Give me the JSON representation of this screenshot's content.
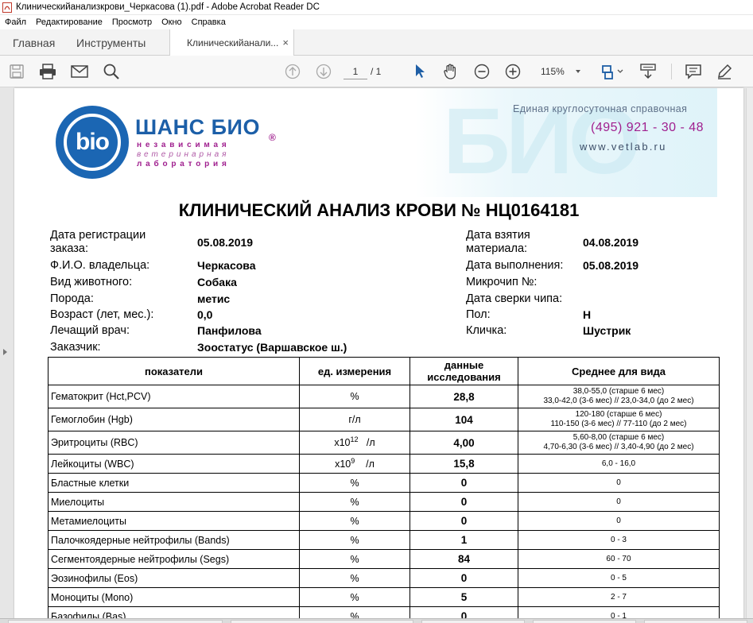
{
  "window": {
    "title": "Клиническийанализкрови_Черкасова (1).pdf - Adobe Acrobat Reader DC"
  },
  "menu": [
    "Файл",
    "Редактирование",
    "Просмотр",
    "Окно",
    "Справка"
  ],
  "tabs": {
    "home": "Главная",
    "tools": "Инструменты",
    "document": "Клиническийанали...",
    "close": "×"
  },
  "toolbar": {
    "page_current": "1",
    "page_total": "/  1",
    "zoom": "115%"
  },
  "header": {
    "logo_text": "bio",
    "brand": "ШАНС БИО",
    "brand_reg": "®",
    "brand_line1": "независимая",
    "brand_line2": "ветеринарная",
    "brand_line3": "лаборатория",
    "watermark": "БИО",
    "contact_label": "Единая круглосуточная справочная",
    "phone": "(495)  921 - 30 - 48",
    "website": "www.vetlab.ru"
  },
  "document": {
    "title": "КЛИНИЧЕСКИЙ АНАЛИЗ КРОВИ  № НЦ0164181"
  },
  "info": {
    "reg_date_label_1": "Дата регистрации",
    "reg_date_label_2": "заказа:",
    "reg_date": "05.08.2019",
    "owner_label": "Ф.И.О. владельца:",
    "owner": "Черкасова",
    "species_label": "Вид животного:",
    "species": "Собака",
    "breed_label": "Порода:",
    "breed": "метис",
    "age_label": "Возраст (лет, мес.):",
    "age": "0,0",
    "doctor_label": "Лечащий врач:",
    "doctor": "Панфилова",
    "customer_label": "Заказчик:",
    "customer": "Зоостатус (Варшавское ш.)",
    "sample_date_label_1": "Дата взятия",
    "sample_date_label_2": "материала:",
    "sample_date": "04.08.2019",
    "done_date_label": "Дата выполнения:",
    "done_date": "05.08.2019",
    "chip_label": "Микрочип №:",
    "chip_check_label": "Дата сверки чипа:",
    "sex_label": "Пол:",
    "sex": "Н",
    "nickname_label": "Кличка:",
    "nickname": "Шустрик"
  },
  "table": {
    "headers": {
      "indicator": "показатели",
      "unit": "ед. измерения",
      "value_1": "данные",
      "value_2": "исследования",
      "ref": "Среднее для вида"
    },
    "rows": [
      {
        "name": "Гематокрит (Hct,PCV)",
        "unit": "%",
        "value": "28,8",
        "ref1": "38,0-55,0 (старше 6 мес)",
        "ref2": "33,0-42,0 (3-6 мес)  //  23,0-34,0 (до 2 мес)"
      },
      {
        "name": "Гемоглобин (Hgb)",
        "unit": "г/л",
        "value": "104",
        "ref1": "120-180 (старше 6 мес)",
        "ref2": "110-150 (3-6 мес)  //  77-110  (до 2 мес)"
      },
      {
        "name": "Эритроциты (RBC)",
        "unit_base": "x10",
        "unit_exp": "12",
        "unit_tail": "/л",
        "value": "4,00",
        "ref1": "5,60-8,00 (старше 6 мес)",
        "ref2": "4,70-6,30 (3-6 мес)  //  3,40-4,90 (до 2 мес)"
      },
      {
        "name": "Лейкоциты (WBC)",
        "unit_base": "x10",
        "unit_exp": "9",
        "unit_tail": "/л",
        "value": "15,8",
        "ref": "6,0 - 16,0"
      },
      {
        "name": "Бластные клетки",
        "unit": "%",
        "value": "0",
        "ref": "0"
      },
      {
        "name": "Миелоциты",
        "unit": "%",
        "value": "0",
        "ref": "0"
      },
      {
        "name": "Метамиелоциты",
        "unit": "%",
        "value": "0",
        "ref": "0"
      },
      {
        "name": "Палочкоядерные нейтрофилы (Bands)",
        "unit": "%",
        "value": "1",
        "ref": "0 - 3"
      },
      {
        "name": "Сегментоядерные нейтрофилы (Segs)",
        "unit": "%",
        "value": "84",
        "ref": "60 - 70"
      },
      {
        "name": "Эозинофилы (Eos)",
        "unit": "%",
        "value": "0",
        "ref": "0 - 5"
      },
      {
        "name": "Моноциты (Mono)",
        "unit": "%",
        "value": "5",
        "ref": "2 - 7"
      },
      {
        "name": "Базофилы (Bas)",
        "unit": "%",
        "value": "0",
        "ref": "0 - 1"
      }
    ]
  },
  "colors": {
    "brand_blue": "#1b66b3",
    "brand_purple": "#a0208f",
    "toolbar_blue": "#1f5fa6"
  }
}
